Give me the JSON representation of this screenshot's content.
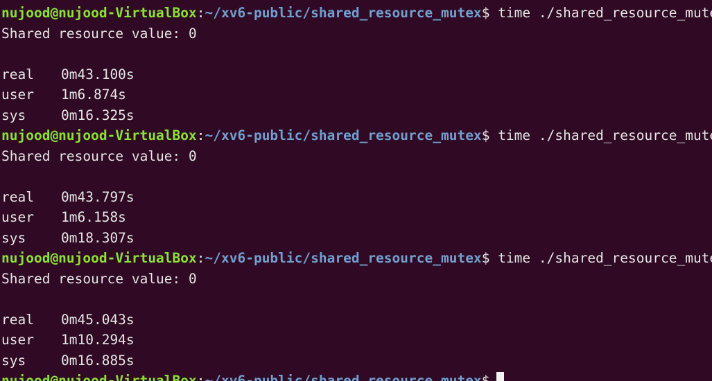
{
  "prompt": {
    "user_host": "nujood@nujood-VirtualBox",
    "colon": ":",
    "path": "~/xv6-public/shared_resource_mutex",
    "dollar": "$"
  },
  "colors": {
    "background": "#300a24",
    "user_host": "#8ae234",
    "path": "#729fcf",
    "text": "#e6e6e6"
  },
  "runs": [
    {
      "command": "time ./shared_resource_mutex",
      "output": "Shared resource value: 0",
      "real_label": "real",
      "real": "0m43.100s",
      "user_label": "user",
      "user": "1m6.874s",
      "sys_label": "sys",
      "sys": "0m16.325s"
    },
    {
      "command": "time ./shared_resource_mutex",
      "output": "Shared resource value: 0",
      "real_label": "real",
      "real": "0m43.797s",
      "user_label": "user",
      "user": "1m6.158s",
      "sys_label": "sys",
      "sys": "0m18.307s"
    },
    {
      "command": "time ./shared_resource_mutex",
      "output": "Shared resource value: 0",
      "real_label": "real",
      "real": "0m45.043s",
      "user_label": "user",
      "user": "1m10.294s",
      "sys_label": "sys",
      "sys": "0m16.885s"
    }
  ],
  "final_prompt": {
    "command": ""
  }
}
